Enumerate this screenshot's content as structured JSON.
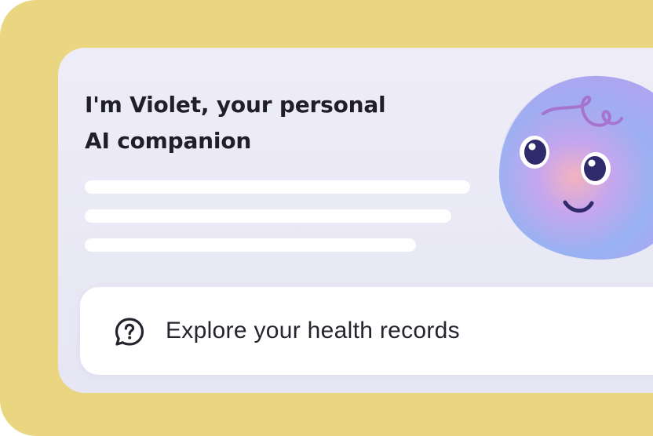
{
  "intro": {
    "headline_line1": "I'm Violet, your personal",
    "headline_line2": "AI companion"
  },
  "action": {
    "label": "Explore your health records",
    "icon": "question-bubble-icon"
  },
  "avatar": {
    "name": "violet-avatar",
    "colors": {
      "top": "#b9a7f0",
      "bottom": "#8ab4f2",
      "cheek": "#f0b3c6",
      "eyes": "#2f2a6b"
    }
  },
  "colors": {
    "background": "#ead581",
    "card": "#eceaf6",
    "text": "#1f1f2b"
  }
}
